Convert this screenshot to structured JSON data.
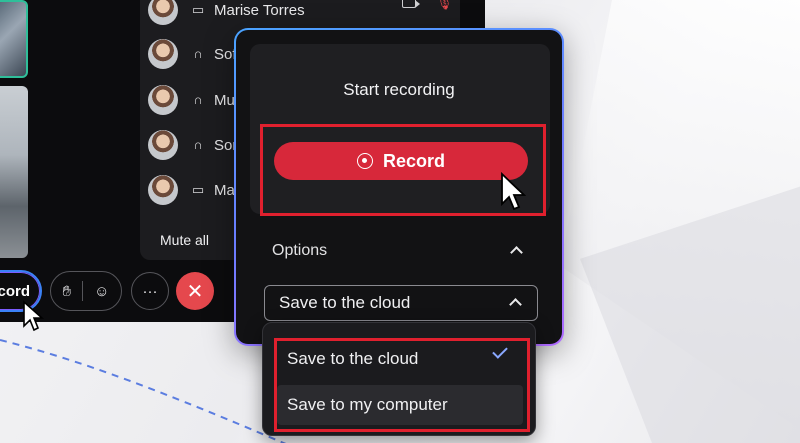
{
  "participants": {
    "rows": [
      {
        "name": "Marise Torres",
        "icon": "screen-icon"
      },
      {
        "name": "Sof",
        "icon": "headset-icon"
      },
      {
        "name": "Mu",
        "icon": "headset-icon"
      },
      {
        "name": "Son",
        "icon": "headset-icon"
      },
      {
        "name": "Ma",
        "icon": "screen-icon"
      }
    ],
    "mute_all": "Mute all"
  },
  "bottom_bar": {
    "record_pill_label": "cord",
    "more_label": "···",
    "leave_label": "✕"
  },
  "recording_panel": {
    "title": "Start recording",
    "record_button": "Record",
    "options_label": "Options",
    "selected_option": "Save to the cloud"
  },
  "dropdown": {
    "options": [
      "Save to the cloud",
      "Save to my computer"
    ],
    "selected_index": 0
  },
  "colors": {
    "accent_red": "#d7283a",
    "highlight_red": "#e0202e",
    "check_blue": "#8aa8ff"
  }
}
